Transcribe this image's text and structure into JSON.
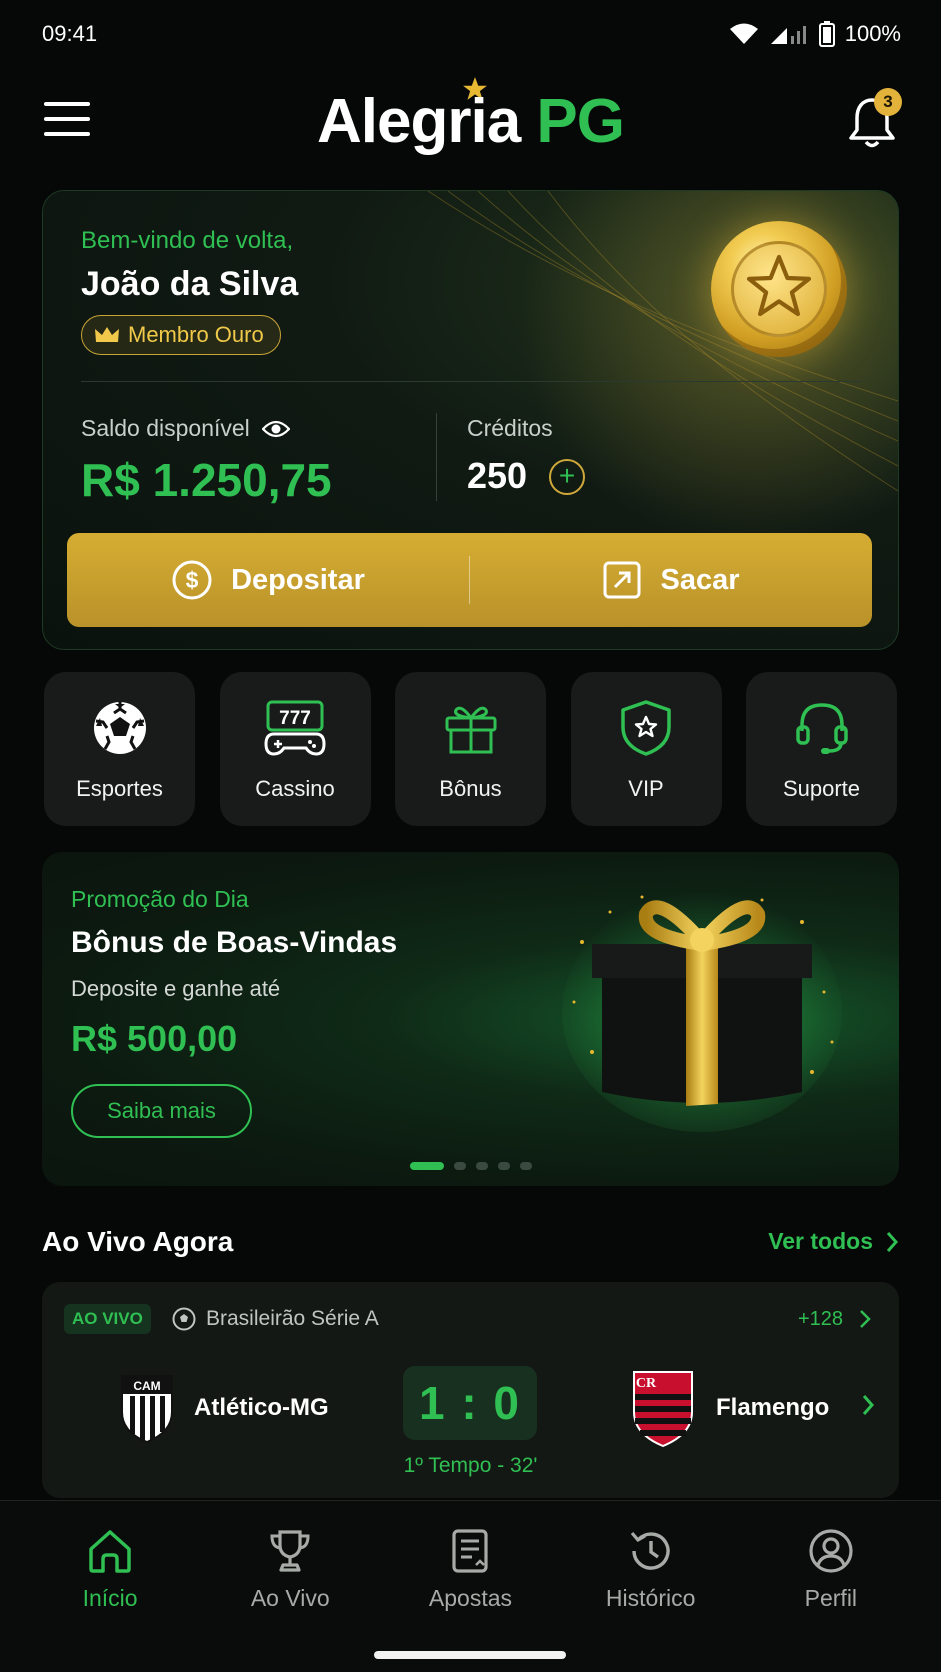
{
  "status_bar": {
    "time": "09:41",
    "battery": "100%"
  },
  "header": {
    "logo_part1": "Alegria",
    "logo_part2": "PG",
    "notification_count": "3"
  },
  "wallet": {
    "welcome": "Bem-vindo de volta,",
    "user_name": "João da Silva",
    "member_badge": "Membro Ouro",
    "balance_label": "Saldo disponível",
    "balance_value": "R$ 1.250,75",
    "credits_label": "Créditos",
    "credits_value": "250",
    "deposit_label": "Depositar",
    "withdraw_label": "Sacar"
  },
  "quick_actions": [
    {
      "label": "Esportes",
      "icon": "soccer-ball-icon"
    },
    {
      "label": "Cassino",
      "icon": "slot-machine-icon"
    },
    {
      "label": "Bônus",
      "icon": "gift-icon"
    },
    {
      "label": "VIP",
      "icon": "shield-star-icon"
    },
    {
      "label": "Suporte",
      "icon": "headset-icon"
    }
  ],
  "promo": {
    "subtitle": "Promoção do Dia",
    "title": "Bônus de Boas-Vindas",
    "description": "Deposite e ganhe até",
    "amount": "R$ 500,00",
    "button": "Saiba mais",
    "slides": 5,
    "active_slide": 1
  },
  "live": {
    "title": "Ao Vivo Agora",
    "see_all": "Ver todos",
    "match": {
      "badge": "AO VIVO",
      "league": "Brasileirão Série A",
      "markets": "+128",
      "home_team": "Atlético-MG",
      "away_team": "Flamengo",
      "score": "1 : 0",
      "time": "1º Tempo - 32'"
    }
  },
  "bottom_nav": [
    {
      "label": "Início",
      "icon": "home-icon",
      "active": true
    },
    {
      "label": "Ao Vivo",
      "icon": "trophy-icon",
      "active": false
    },
    {
      "label": "Apostas",
      "icon": "bet-slip-icon",
      "active": false
    },
    {
      "label": "Histórico",
      "icon": "history-icon",
      "active": false
    },
    {
      "label": "Perfil",
      "icon": "profile-icon",
      "active": false
    }
  ],
  "colors": {
    "accent_green": "#2fbf52",
    "gold": "#d6ad32",
    "background": "#060807"
  }
}
